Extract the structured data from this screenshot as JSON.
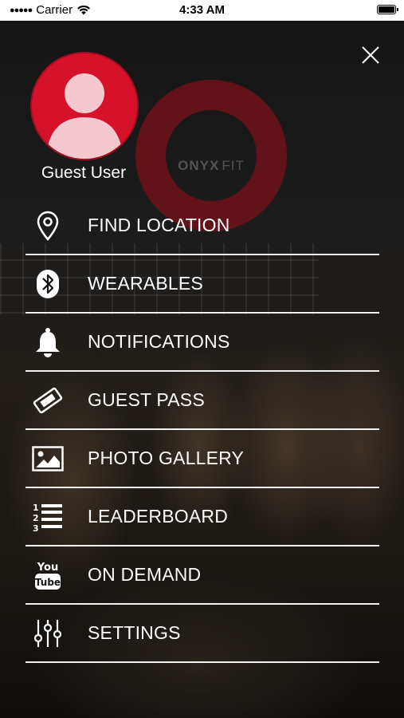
{
  "status_bar": {
    "carrier": "Carrier",
    "time": "4:33 AM"
  },
  "background": {
    "logo_primary": "ONYX",
    "logo_secondary": "FIT"
  },
  "profile": {
    "name": "Guest User",
    "avatar_icon": "person-icon",
    "avatar_color": "#d6112a"
  },
  "menu": {
    "items": [
      {
        "label": "FIND LOCATION",
        "icon": "location-pin-icon"
      },
      {
        "label": "WEARABLES",
        "icon": "bluetooth-icon"
      },
      {
        "label": "NOTIFICATIONS",
        "icon": "bell-icon"
      },
      {
        "label": "GUEST PASS",
        "icon": "ticket-icon"
      },
      {
        "label": "PHOTO GALLERY",
        "icon": "image-icon"
      },
      {
        "label": "LEADERBOARD",
        "icon": "numbered-list-icon"
      },
      {
        "label": "ON DEMAND",
        "icon": "youtube-icon"
      },
      {
        "label": "SETTINGS",
        "icon": "sliders-icon"
      }
    ]
  },
  "colors": {
    "accent": "#d6112a",
    "divider": "#f2f2f2"
  }
}
